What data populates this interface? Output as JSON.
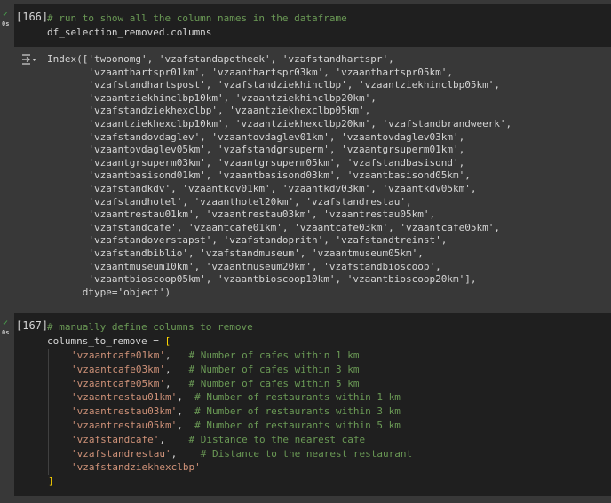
{
  "cells": [
    {
      "exec_count": "[166]",
      "status_icon": "check-icon",
      "duration": "0s",
      "code_lines": [
        {
          "comment": "# run to show all the column names in the dataframe"
        },
        {
          "text": "df_selection_removed.columns"
        }
      ],
      "output_icon": "output-toggle-icon",
      "output_lines": [
        "Index(['twoonomg', 'vzafstandapotheek', 'vzafstandhartspr',",
        "       'vzaanthartspr01km', 'vzaanthartspr03km', 'vzaanthartspr05km',",
        "       'vzafstandhartspost', 'vzafstandziekhinclbp', 'vzaantziekhinclbp05km',",
        "       'vzaantziekhinclbp10km', 'vzaantziekhinclbp20km',",
        "       'vzafstandziekhexclbp', 'vzaantziekhexclbp05km',",
        "       'vzaantziekhexclbp10km', 'vzaantziekhexclbp20km', 'vzafstandbrandweerk',",
        "       'vzafstandovdaglev', 'vzaantovdaglev01km', 'vzaantovdaglev03km',",
        "       'vzaantovdaglev05km', 'vzafstandgrsuperm', 'vzaantgrsuperm01km',",
        "       'vzaantgrsuperm03km', 'vzaantgrsuperm05km', 'vzafstandbasisond',",
        "       'vzaantbasisond01km', 'vzaantbasisond03km', 'vzaantbasisond05km',",
        "       'vzafstandkdv', 'vzaantkdv01km', 'vzaantkdv03km', 'vzaantkdv05km',",
        "       'vzafstandhotel', 'vzaanthotel20km', 'vzafstandrestau',",
        "       'vzaantrestau01km', 'vzaantrestau03km', 'vzaantrestau05km',",
        "       'vzafstandcafe', 'vzaantcafe01km', 'vzaantcafe03km', 'vzaantcafe05km',",
        "       'vzafstandoverstapst', 'vzafstandoprith', 'vzafstandtreinst',",
        "       'vzafstandbiblio', 'vzafstandmuseum', 'vzaantmuseum05km',",
        "       'vzaantmuseum10km', 'vzaantmuseum20km', 'vzafstandbioscoop',",
        "       'vzaantbioscoop05km', 'vzaantbioscoop10km', 'vzaantbioscoop20km'],",
        "      dtype='object')"
      ]
    },
    {
      "exec_count": "[167]",
      "status_icon": "check-icon",
      "duration": "0s",
      "comment": "# manually define columns to remove",
      "assign": "columns_to_remove = ",
      "open_bracket": "[",
      "close_bracket": "]",
      "items": [
        {
          "str": "'vzaantcafe01km'",
          "sep": ",   ",
          "comment": "# Number of cafes within 1 km"
        },
        {
          "str": "'vzaantcafe03km'",
          "sep": ",   ",
          "comment": "# Number of cafes within 3 km"
        },
        {
          "str": "'vzaantcafe05km'",
          "sep": ",   ",
          "comment": "# Number of cafes within 5 km"
        },
        {
          "str": "'vzaantrestau01km'",
          "sep": ",  ",
          "comment": "# Number of restaurants within 1 km"
        },
        {
          "str": "'vzaantrestau03km'",
          "sep": ",  ",
          "comment": "# Number of restaurants within 3 km"
        },
        {
          "str": "'vzaantrestau05km'",
          "sep": ",  ",
          "comment": "# Number of restaurants within 5 km"
        },
        {
          "str": "'vzafstandcafe'",
          "sep": ",    ",
          "comment": "# Distance to the nearest cafe"
        },
        {
          "str": "'vzafstandrestau'",
          "sep": ",    ",
          "comment": "# Distance to the nearest restaurant"
        },
        {
          "str": "'vzafstandziekhexclbp'",
          "sep": "",
          "comment": ""
        }
      ]
    }
  ]
}
